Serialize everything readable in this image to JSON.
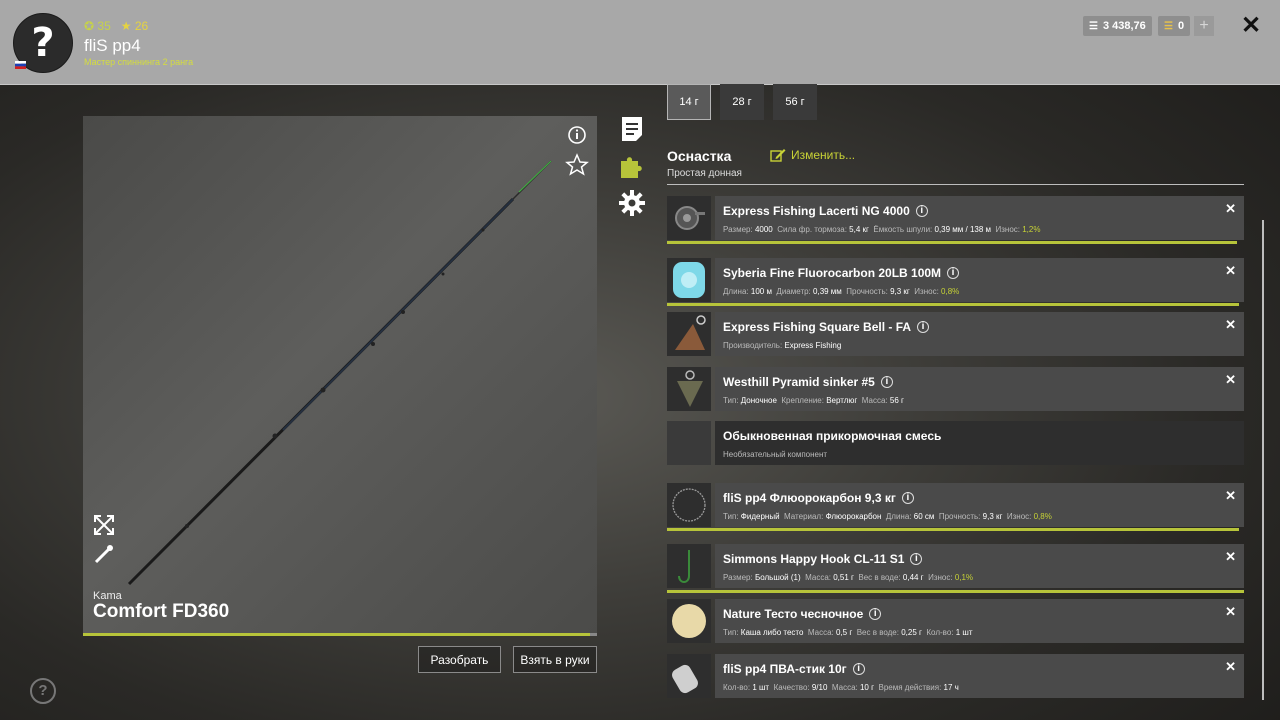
{
  "header": {
    "avatar_symbol": "?",
    "stat_coins": "35",
    "stat_stars": "26",
    "username": "fliS pp4",
    "rank": "Мастер спиннинга 2 ранга",
    "silver": "3 438,76",
    "gold": "0",
    "plus": "+",
    "close": "✕"
  },
  "rod": {
    "brand": "Kama",
    "name": "Comfort FD360",
    "btn_disassemble": "Разобрать",
    "btn_take": "Взять в руки"
  },
  "help": "?",
  "weights": [
    "14 г",
    "28 г",
    "56 г"
  ],
  "rig": {
    "title": "Оснастка",
    "edit": "Изменить...",
    "subtitle": "Простая донная"
  },
  "items": [
    {
      "name": "Express Fishing Lacerti NG 4000",
      "details": [
        [
          "Размер:",
          "4000"
        ],
        [
          "Сила фр. тормоза:",
          "5,4 кг"
        ],
        [
          "Ёмкость шпули:",
          "0,39 мм / 138 м"
        ],
        [
          "Износ:",
          "1,2%"
        ]
      ]
    },
    {
      "name": "Syberia Fine Fluorocarbon 20LB 100M",
      "details": [
        [
          "Длина:",
          "100 м"
        ],
        [
          "Диаметр:",
          "0,39 мм"
        ],
        [
          "Прочность:",
          "9,3 кг"
        ],
        [
          "Износ:",
          "0,8%"
        ]
      ]
    },
    {
      "name": "Express Fishing Square Bell - FA",
      "details": [
        [
          "Производитель:",
          "Express Fishing"
        ]
      ]
    },
    {
      "name": "Westhill Pyramid sinker #5",
      "details": [
        [
          "Тип:",
          "Доночное"
        ],
        [
          "Крепление:",
          "Вертлюг"
        ],
        [
          "Масса:",
          "56 г"
        ]
      ]
    },
    {
      "name": "Обыкновенная прикормочная смесь",
      "details": [
        [
          "Необязательный компонент",
          ""
        ]
      ]
    },
    {
      "name": "fliS pp4 Флюорокарбон 9,3 кг",
      "details": [
        [
          "Тип:",
          "Фидерный"
        ],
        [
          "Материал:",
          "Флюорокарбон"
        ],
        [
          "Длина:",
          "60 см"
        ],
        [
          "Прочность:",
          "9,3 кг"
        ],
        [
          "Износ:",
          "0,8%"
        ]
      ]
    },
    {
      "name": "Simmons Happy Hook CL-11 S1",
      "details": [
        [
          "Размер:",
          "Большой (1)"
        ],
        [
          "Масса:",
          "0,51 г"
        ],
        [
          "Вес в воде:",
          "0,44 г"
        ],
        [
          "Износ:",
          "0,1%"
        ]
      ]
    },
    {
      "name": "Nature Тесто чесночное",
      "details": [
        [
          "Тип:",
          "Каша либо тесто"
        ],
        [
          "Масса:",
          "0,5 г"
        ],
        [
          "Вес в воде:",
          "0,25 г"
        ],
        [
          "Кол-во:",
          "1 шт"
        ]
      ]
    },
    {
      "name": "fliS pp4 ПВА-стик 10г",
      "details": [
        [
          "Кол-во:",
          "1 шт"
        ],
        [
          "Качество:",
          "9/10"
        ],
        [
          "Масса:",
          "10 г"
        ],
        [
          "Время действия:",
          "17 ч"
        ]
      ]
    }
  ],
  "colors": {
    "accent": "#b7c43a",
    "header_bg": "#a8a8a8"
  }
}
